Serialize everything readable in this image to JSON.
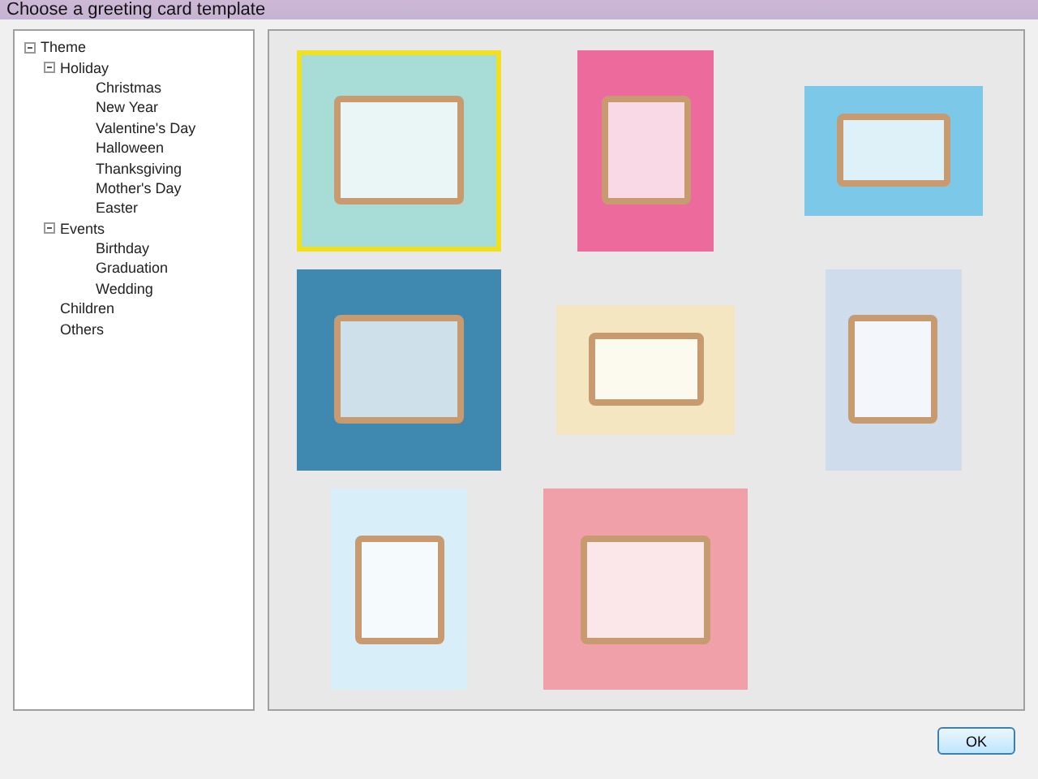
{
  "window": {
    "title": "Choose a greeting card template"
  },
  "tree": [
    {
      "label": "Theme",
      "expanded": true,
      "children": [
        {
          "label": "Holiday",
          "expanded": true,
          "children": [
            {
              "label": "Christmas"
            },
            {
              "label": "New Year"
            },
            {
              "label": "Valentine's Day"
            },
            {
              "label": "Halloween"
            },
            {
              "label": "Thanksgiving"
            },
            {
              "label": "Mother's Day"
            },
            {
              "label": "Easter"
            }
          ]
        },
        {
          "label": "Events",
          "expanded": true,
          "children": [
            {
              "label": "Birthday"
            },
            {
              "label": "Graduation"
            },
            {
              "label": "Wedding"
            }
          ]
        },
        {
          "label": "Children"
        },
        {
          "label": "Others"
        }
      ]
    }
  ],
  "templates": [
    {
      "kind": "square",
      "color": "#a8dcd6",
      "selected": true
    },
    {
      "kind": "portrait",
      "color": "#ec6a9c",
      "selected": false
    },
    {
      "kind": "landscape",
      "color": "#7cc8e8",
      "selected": false
    },
    {
      "kind": "square",
      "color": "#3f88b0",
      "selected": false
    },
    {
      "kind": "landscape",
      "color": "#f4e6c0",
      "selected": false
    },
    {
      "kind": "portrait",
      "color": "#cfdcec",
      "selected": false
    },
    {
      "kind": "portrait",
      "color": "#d8eef8",
      "selected": false
    },
    {
      "kind": "square",
      "color": "#f0a0a8",
      "selected": false
    }
  ],
  "buttons": [
    {
      "label": "OK"
    }
  ]
}
